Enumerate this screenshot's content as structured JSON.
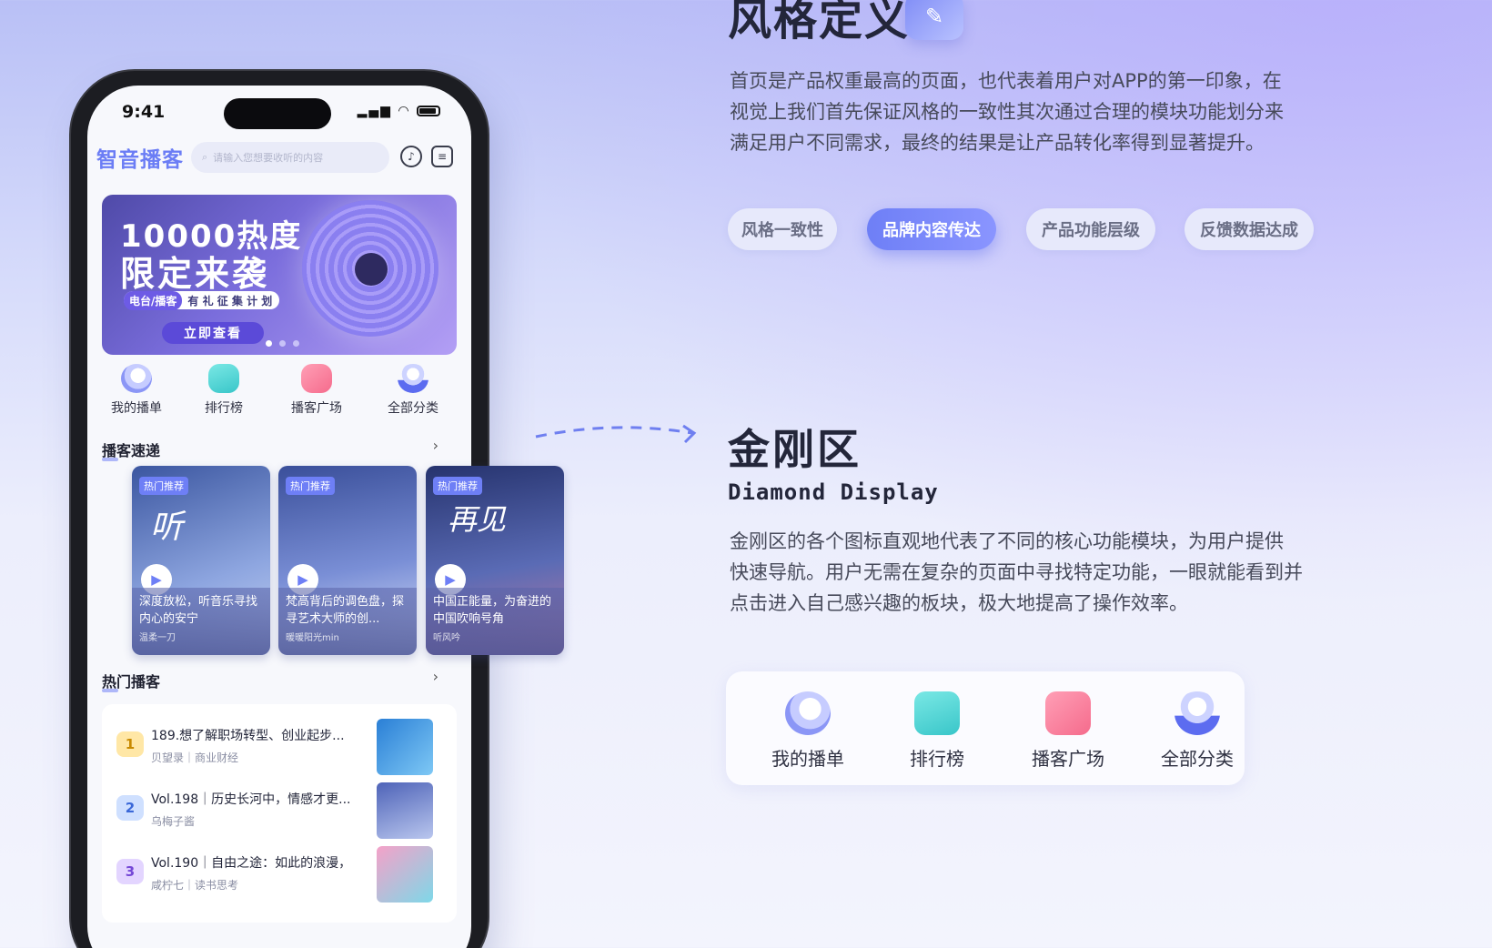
{
  "right": {
    "title_top": "风格定义",
    "desc_top": [
      "首页是产品权重最高的页面，也代表着用户对APP的第一印象，在",
      "视觉上我们首先保证风格的一致性其次通过合理的模块功能划分来",
      "满足用户不同需求，最终的结果是让产品转化率得到显著提升。"
    ],
    "pills": [
      "风格一致性",
      "品牌内容传达",
      "产品功能层级",
      "反馈数据达成"
    ],
    "active_pill_index": 1,
    "section_title": "金刚区",
    "section_subtitle": "Diamond Display",
    "section_desc": [
      "金刚区的各个图标直观地代表了不同的核心功能模块，为用户提供",
      "快速导航。用户无需在复杂的页面中寻找特定功能，一眼就能看到并",
      "点击进入自己感兴趣的板块，极大地提高了操作效率。"
    ],
    "diamond_items": [
      {
        "label": "我的播单",
        "icon": "playlist-icon"
      },
      {
        "label": "排行榜",
        "icon": "ranking-icon"
      },
      {
        "label": "播客广场",
        "icon": "podcast-square-icon"
      },
      {
        "label": "全部分类",
        "icon": "all-categories-icon"
      }
    ]
  },
  "phone": {
    "status_time": "9:41",
    "app_name": "智音播客",
    "search_placeholder": "请输入您想要收听的内容",
    "banner": {
      "line1": "10000热度",
      "line2": "限定来袭",
      "tag_highlight": "电台/播客",
      "tag_text": "有 礼 征 集 计 划",
      "button": "立即查看"
    },
    "kingkong": [
      "我的播单",
      "排行榜",
      "播客广场",
      "全部分类"
    ],
    "section_quick": "播客速递",
    "section_hot": "热门播客",
    "cards": [
      {
        "badge": "热门推荐",
        "title": "深度放松，听音乐寻找内心的安宁",
        "author": "温柔一刀"
      },
      {
        "badge": "热门推荐",
        "title": "梵高背后的调色盘，探寻艺术大师的创...",
        "author": "暖暖阳光min"
      },
      {
        "badge": "热门推荐",
        "title": "中国正能量，为奋进的中国吹响号角",
        "author": "听风吟"
      }
    ],
    "hot": [
      {
        "rank": "1",
        "title": "189.想了解职场转型、创业起步...",
        "meta": "贝望录｜商业财经"
      },
      {
        "rank": "2",
        "title": "Vol.198｜历史长河中，情感才更...",
        "meta": "乌梅子酱"
      },
      {
        "rank": "3",
        "title": "Vol.190｜自由之途：如此的浪漫，",
        "meta": "咸柠七｜读书思考"
      }
    ]
  }
}
